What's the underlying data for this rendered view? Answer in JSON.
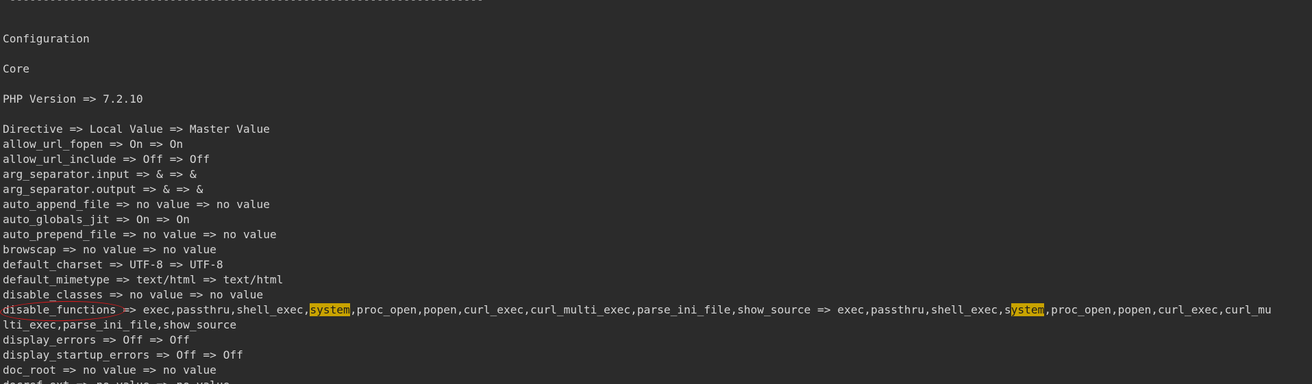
{
  "separator": " -----------------------------------------------------------------------",
  "headings": {
    "configuration": "Configuration",
    "core": "Core",
    "php_version": "PHP Version => 7.2.10"
  },
  "table_header": "Directive => Local Value => Master Value",
  "directives": {
    "allow_url_fopen": "allow_url_fopen => On => On",
    "allow_url_include": "allow_url_include => Off => Off",
    "arg_separator_input": "arg_separator.input => & => &",
    "arg_separator_output": "arg_separator.output => & => &",
    "auto_append_file": "auto_append_file => no value => no value",
    "auto_globals_jit": "auto_globals_jit => On => On",
    "auto_prepend_file": "auto_prepend_file => no value => no value",
    "browscap": "browscap => no value => no value",
    "default_charset": "default_charset => UTF-8 => UTF-8",
    "default_mimetype": "default_mimetype => text/html => text/html",
    "disable_classes": "disable_classes => no value => no value",
    "disable_functions": {
      "name": "disable_functions",
      "part1": " => exec,passthru,shell_exec,",
      "hl1": "system",
      "part2": ",proc_open,popen,curl_exec,curl_multi_exec,parse_ini_file,show_source => exec,passthru,shell_exec,s",
      "hl2": "ystem",
      "part3": ",proc_open,popen,curl_exec,curl_mu",
      "wrap": "lti_exec,parse_ini_file,show_source"
    },
    "display_errors": "display_errors => Off => Off",
    "display_startup_errors": "display_startup_errors => Off => Off",
    "doc_root": "doc_root => no value => no value",
    "docref_ext": "docref_ext => no value => no value"
  },
  "colors": {
    "background": "#2b2b2b",
    "text": "#d6d6d6",
    "highlight": "#c9a300",
    "annotation_circle": "#e0191c"
  }
}
